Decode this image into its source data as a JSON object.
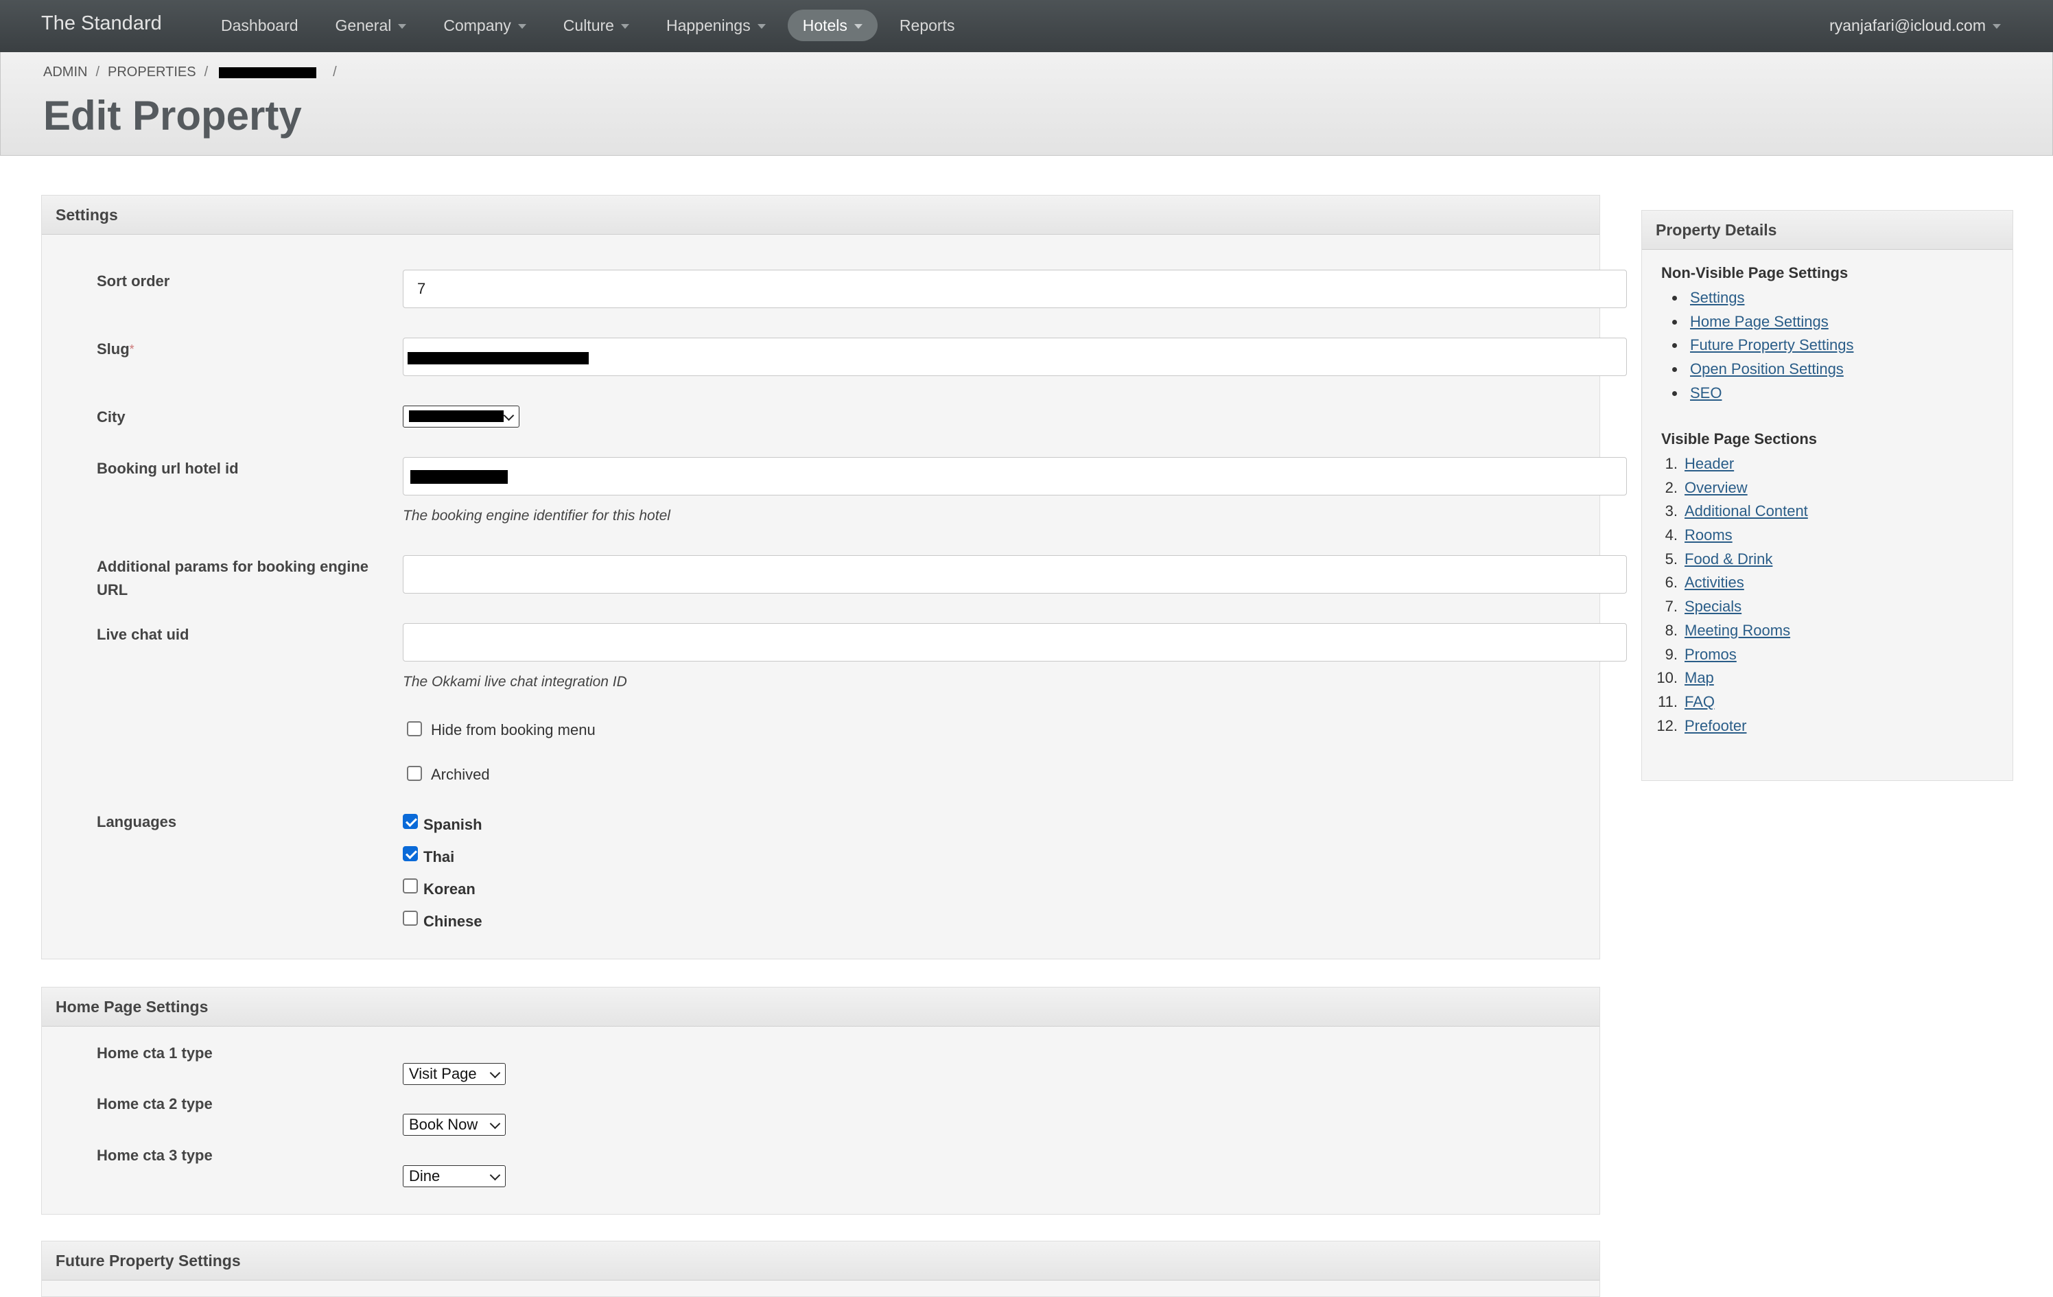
{
  "nav": {
    "brand": "The Standard",
    "items": [
      {
        "label": "Dashboard",
        "dropdown": false,
        "active": false
      },
      {
        "label": "General",
        "dropdown": true,
        "active": false
      },
      {
        "label": "Company",
        "dropdown": true,
        "active": false
      },
      {
        "label": "Culture",
        "dropdown": true,
        "active": false
      },
      {
        "label": "Happenings",
        "dropdown": true,
        "active": false
      },
      {
        "label": "Hotels",
        "dropdown": true,
        "active": true
      },
      {
        "label": "Reports",
        "dropdown": false,
        "active": false
      }
    ],
    "user": "ryanjafari@icloud.com"
  },
  "breadcrumb": {
    "admin": "ADMIN",
    "properties": "PROPERTIES",
    "separator": "/"
  },
  "page": {
    "title": "Edit Property"
  },
  "settings": {
    "heading": "Settings",
    "sort_order": {
      "label": "Sort order",
      "value": "7"
    },
    "slug": {
      "label": "Slug",
      "required_mark": "*"
    },
    "city": {
      "label": "City"
    },
    "booking_hotel_id": {
      "label": "Booking url hotel id",
      "help": "The booking engine identifier for this hotel"
    },
    "additional_params": {
      "label": "Additional params for booking engine URL",
      "value": ""
    },
    "live_chat": {
      "label": "Live chat uid",
      "value": "",
      "help": "The Okkami live chat integration ID"
    },
    "hide_from_booking": {
      "label": "Hide from booking menu",
      "checked": false
    },
    "archived": {
      "label": "Archived",
      "checked": false
    },
    "languages": {
      "label": "Languages",
      "options": [
        {
          "label": "Spanish",
          "checked": true
        },
        {
          "label": "Thai",
          "checked": true
        },
        {
          "label": "Korean",
          "checked": false
        },
        {
          "label": "Chinese",
          "checked": false
        }
      ]
    }
  },
  "home_page_settings": {
    "heading": "Home Page Settings",
    "cta1": {
      "label": "Home cta 1 type",
      "value": "Visit Page"
    },
    "cta2": {
      "label": "Home cta 2 type",
      "value": "Book Now"
    },
    "cta3": {
      "label": "Home cta 3 type",
      "value": "Dine"
    }
  },
  "future_property_settings": {
    "heading": "Future Property Settings"
  },
  "property_details": {
    "heading": "Property Details",
    "non_visible_title": "Non-Visible Page Settings",
    "non_visible_links": [
      "Settings",
      "Home Page Settings",
      "Future Property Settings",
      "Open Position Settings",
      "SEO"
    ],
    "visible_title": "Visible Page Sections",
    "visible_links": [
      "Header",
      "Overview",
      "Additional Content",
      "Rooms",
      "Food & Drink",
      "Activities",
      "Specials",
      "Meeting Rooms",
      "Promos",
      "Map",
      "FAQ",
      "Prefooter"
    ]
  }
}
